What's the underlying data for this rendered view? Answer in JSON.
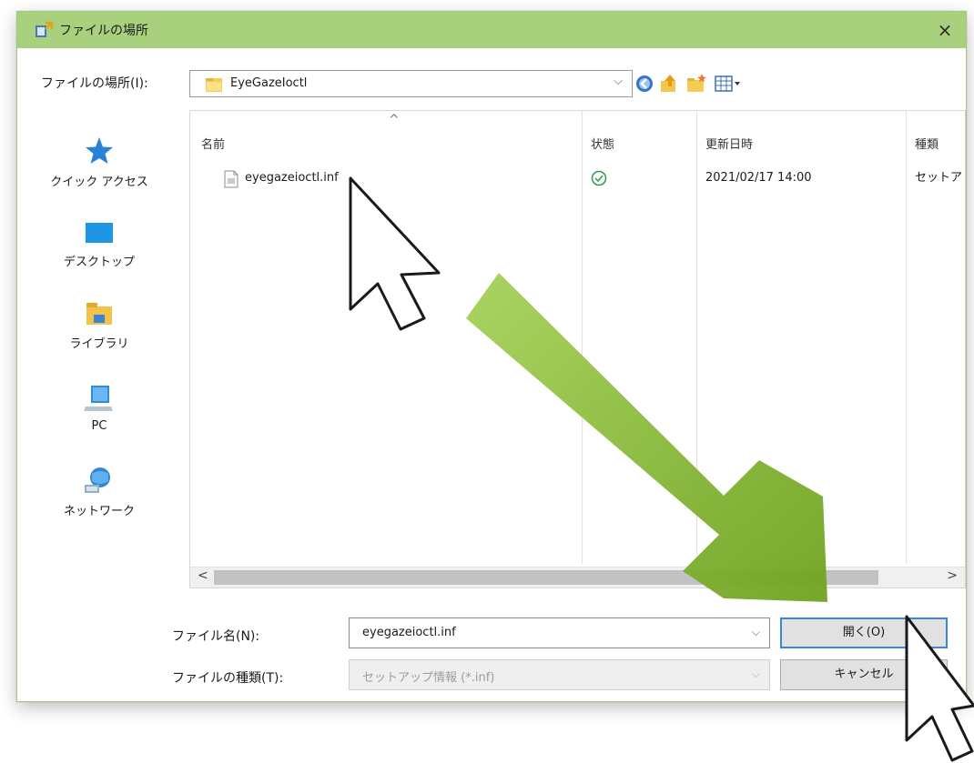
{
  "window": {
    "title": "ファイルの場所",
    "close_glyph": "×"
  },
  "lookin": {
    "label": "ファイルの場所(I):",
    "value": "EyeGazeIoctl",
    "arrow": "⌵"
  },
  "toolbar": {
    "icons": [
      "back-icon",
      "up-folder-icon",
      "new-folder-icon",
      "view-menu-icon"
    ]
  },
  "places": [
    {
      "label": "クイック アクセス",
      "icon": "star-icon"
    },
    {
      "label": "デスクトップ",
      "icon": "desktop-icon"
    },
    {
      "label": "ライブラリ",
      "icon": "library-icon"
    },
    {
      "label": "PC",
      "icon": "pc-icon"
    },
    {
      "label": "ネットワーク",
      "icon": "network-icon"
    }
  ],
  "filelist": {
    "sort_caret": "^",
    "columns": [
      "名前",
      "状態",
      "更新日時",
      "種類"
    ],
    "rows": [
      {
        "name": "eyegazeioctl.inf",
        "status_icon": "check-circle-icon",
        "modified": "2021/02/17 14:00",
        "type": "セットア"
      }
    ],
    "scroll_left": "<",
    "scroll_right": ">"
  },
  "filename": {
    "label": "ファイル名(N):",
    "value": "eyegazeioctl.inf",
    "arrow": "⌵"
  },
  "filetype": {
    "label": "ファイルの種類(T):",
    "value": "セットアップ情報 (*.inf)",
    "arrow": "⌵"
  },
  "buttons": {
    "open": "開く(O)",
    "cancel": "キャンセル"
  },
  "colors": {
    "titlebar": "#a9d07c",
    "arrow_green": "#7fb32a",
    "accent_blue": "#3c86d8"
  }
}
